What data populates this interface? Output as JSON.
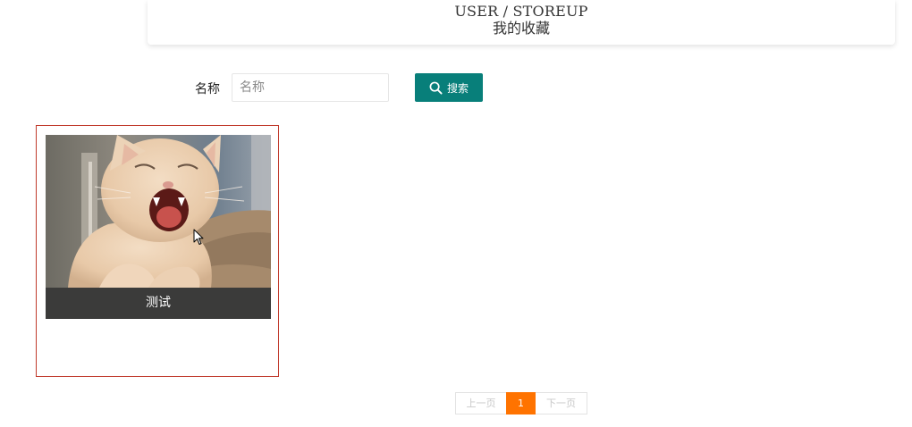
{
  "header": {
    "breadcrumb": "USER / STOREUP",
    "title": "我的收藏"
  },
  "search": {
    "label": "名称",
    "placeholder": "名称",
    "value": "",
    "button_label": "搜索",
    "button_icon": "search-icon"
  },
  "items": [
    {
      "caption": "测试",
      "image": "yawning-cat-photo"
    }
  ],
  "pagination": {
    "prev_label": "上一页",
    "current_page": "1",
    "next_label": "下一页"
  },
  "colors": {
    "accent": "#087f7a",
    "card_border": "#c0392b",
    "caption_bg": "#3b3b3a",
    "active_page": "#ff7300"
  }
}
